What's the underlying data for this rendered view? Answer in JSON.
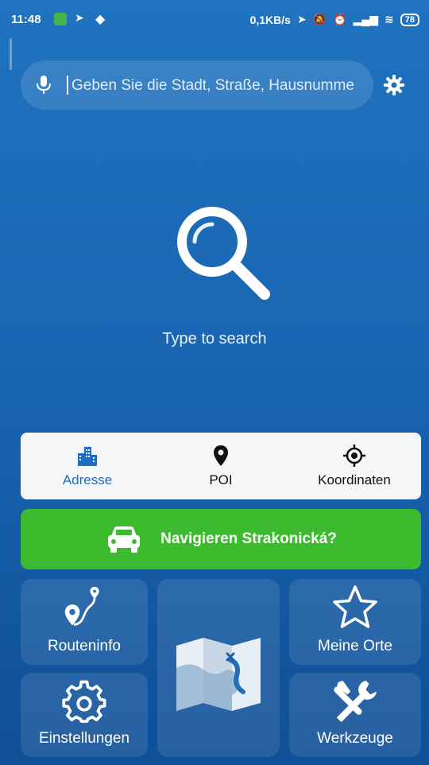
{
  "status_bar": {
    "time": "11:48",
    "network_speed": "0,1KB/s",
    "battery": "78"
  },
  "search": {
    "placeholder": "Geben Sie die Stadt, Straße, Hausnumme"
  },
  "empty_state": {
    "text": "Type to search"
  },
  "tabs": [
    {
      "label": "Adresse",
      "icon": "buildings-icon",
      "active": true
    },
    {
      "label": "POI",
      "icon": "map-pin-icon",
      "active": false
    },
    {
      "label": "Koordinaten",
      "icon": "crosshair-icon",
      "active": false
    }
  ],
  "navigate": {
    "label": "Navigieren Strakonická?",
    "icon": "car-icon"
  },
  "tiles": {
    "routeninfo": {
      "label": "Routeninfo",
      "icon": "route-icon"
    },
    "einstellungen": {
      "label": "Einstellungen",
      "icon": "gear-icon"
    },
    "map": {
      "icon": "map-icon"
    },
    "meine_orte": {
      "label": "Meine Orte",
      "icon": "star-icon"
    },
    "werkzeuge": {
      "label": "Werkzeuge",
      "icon": "tools-icon"
    }
  },
  "colors": {
    "background": "#1a66b3",
    "accent_blue": "#1c6fc3",
    "navigate_green": "#3dbb2e"
  }
}
